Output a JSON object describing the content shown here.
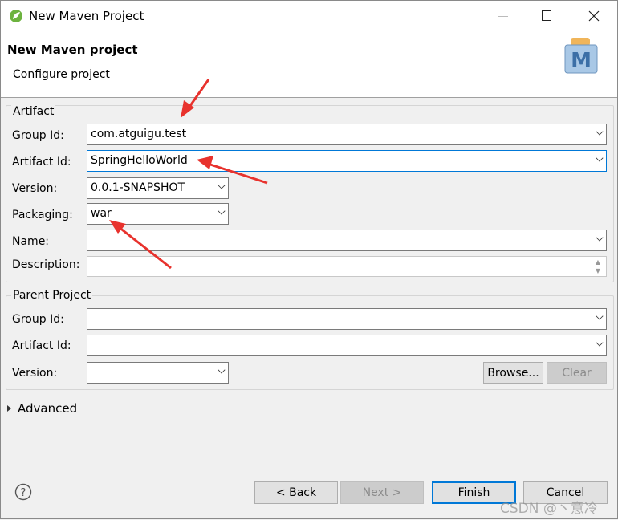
{
  "window": {
    "title": "New Maven Project"
  },
  "header": {
    "title": "New Maven project",
    "subtitle": "Configure project",
    "icon": "maven-m-icon"
  },
  "artifact": {
    "legend": "Artifact",
    "group_id": {
      "label": "Group Id:",
      "value": "com.atguigu.test"
    },
    "artifact_id": {
      "label": "Artifact Id:",
      "value": "SpringHelloWorld"
    },
    "version": {
      "label": "Version:",
      "value": "0.0.1-SNAPSHOT"
    },
    "packaging": {
      "label": "Packaging:",
      "value": "war"
    },
    "name": {
      "label": "Name:",
      "value": ""
    },
    "description": {
      "label": "Description:",
      "value": ""
    }
  },
  "parent": {
    "legend": "Parent Project",
    "group_id": {
      "label": "Group Id:",
      "value": ""
    },
    "artifact_id": {
      "label": "Artifact Id:",
      "value": ""
    },
    "version": {
      "label": "Version:",
      "value": ""
    },
    "browse": "Browse...",
    "clear": "Clear"
  },
  "advanced": "Advanced",
  "buttons": {
    "back": "< Back",
    "next": "Next >",
    "finish": "Finish",
    "cancel": "Cancel"
  },
  "watermark": "CSDN @丶意冷",
  "colors": {
    "focus": "#0078d7",
    "annotation_arrow": "#e8322d"
  }
}
